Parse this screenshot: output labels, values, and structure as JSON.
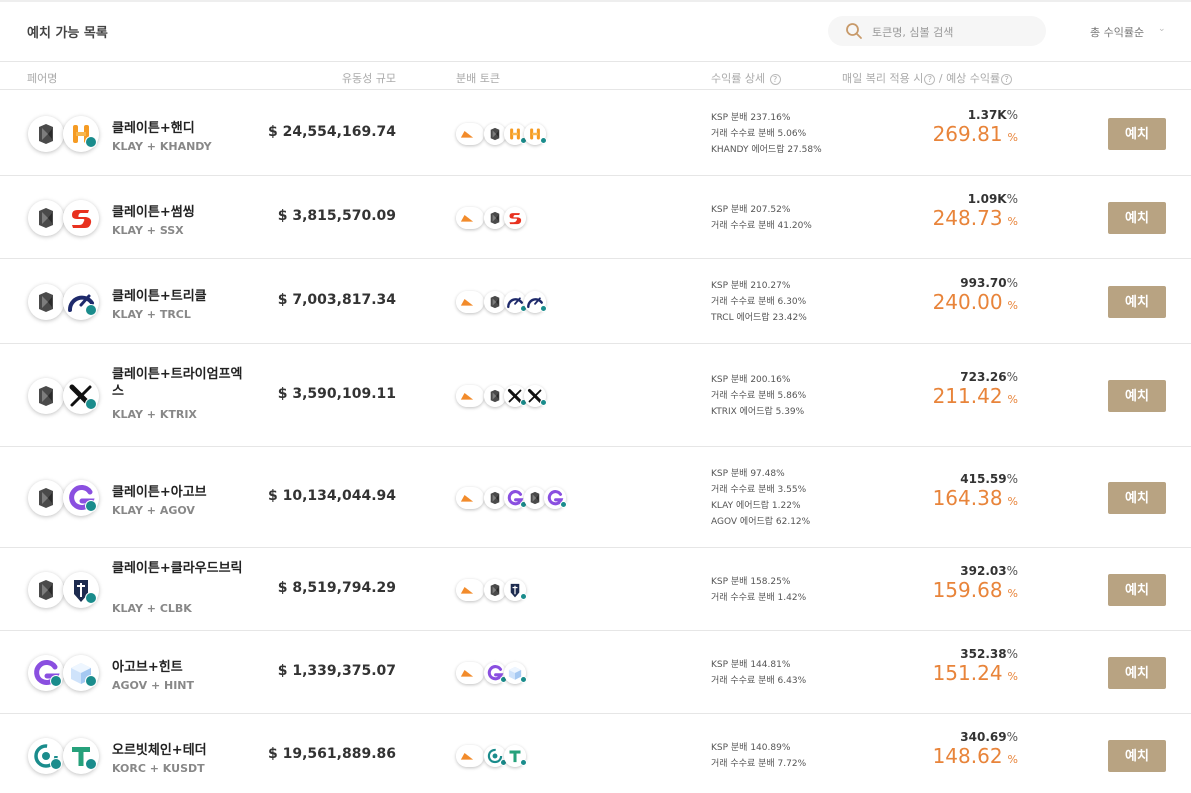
{
  "header": {
    "title": "예치 가능 목록",
    "search_placeholder": "토큰명, 심볼 검색",
    "sort_label": "총 수익률순"
  },
  "columns": {
    "pair": "페어명",
    "liquidity": "유동성 규모",
    "reward_tokens": "분배 토큰",
    "yield_detail": "수익률 상세",
    "daily_compound": "매일 복리 적용 시",
    "slash": "/",
    "expected_yield": "예상 수익률"
  },
  "colors": {
    "accent_orange": "#e8843a",
    "button_bg": "#b8a382",
    "badge_teal": "#1a8c8c"
  },
  "pct_sign": "%",
  "deposit_label": "예치",
  "pools": [
    {
      "name": "클레이튼+핸디",
      "symbols": "KLAY + KHANDY",
      "tvl": "$ 24,554,169.74",
      "token_a_icon": "klay-icon",
      "token_b_icon": "khandy-icon",
      "details": [
        "KSP 분배 237.16%",
        "거래 수수료 분배 5.06%",
        "KHANDY 에어드랍 27.58%"
      ],
      "daily": "1.37K",
      "apr": "269.81",
      "dist_icons": [
        "ksp-icon",
        "klay-icon",
        "khandy-icon",
        "khandy-icon"
      ]
    },
    {
      "name": "클레이튼+썸씽",
      "symbols": "KLAY + SSX",
      "tvl": "$ 3,815,570.09",
      "token_a_icon": "klay-icon",
      "token_b_icon": "ssx-icon",
      "details": [
        "KSP 분배 207.52%",
        "거래 수수료 분배 41.20%"
      ],
      "daily": "1.09K",
      "apr": "248.73",
      "dist_icons": [
        "ksp-icon",
        "klay-icon",
        "ssx-icon"
      ]
    },
    {
      "name": "클레이튼+트리클",
      "symbols": "KLAY + TRCL",
      "tvl": "$ 7,003,817.34",
      "token_a_icon": "klay-icon",
      "token_b_icon": "trcl-icon",
      "details": [
        "KSP 분배 210.27%",
        "거래 수수료 분배 6.30%",
        "TRCL 에어드랍 23.42%"
      ],
      "daily": "993.70",
      "apr": "240.00",
      "dist_icons": [
        "ksp-icon",
        "klay-icon",
        "trcl-icon",
        "trcl-icon"
      ]
    },
    {
      "name": "클레이튼+트라이엄프엑스",
      "symbols": "KLAY + KTRIX",
      "tvl": "$ 3,590,109.11",
      "token_a_icon": "klay-icon",
      "token_b_icon": "ktrix-icon",
      "details": [
        "KSP 분배 200.16%",
        "거래 수수료 분배 5.86%",
        "KTRIX 에어드랍 5.39%"
      ],
      "daily": "723.26",
      "apr": "211.42",
      "dist_icons": [
        "ksp-icon",
        "klay-icon",
        "ktrix-icon",
        "ktrix-icon"
      ]
    },
    {
      "name": "클레이튼+아고브",
      "symbols": "KLAY + AGOV",
      "tvl": "$ 10,134,044.94",
      "token_a_icon": "klay-icon",
      "token_b_icon": "agov-icon",
      "details": [
        "KSP 분배 97.48%",
        "거래 수수료 분배 3.55%",
        "KLAY 에어드랍 1.22%",
        "AGOV 에어드랍 62.12%"
      ],
      "daily": "415.59",
      "apr": "164.38",
      "dist_icons": [
        "ksp-icon",
        "klay-icon",
        "agov-icon",
        "klay-icon",
        "agov-icon"
      ]
    },
    {
      "name": "클레이튼+클라우드브릭",
      "symbols": "KLAY + CLBK",
      "tvl": "$ 8,519,794.29",
      "token_a_icon": "klay-icon",
      "token_b_icon": "clbk-icon",
      "details": [
        "KSP 분배 158.25%",
        "거래 수수료 분배 1.42%"
      ],
      "daily": "392.03",
      "apr": "159.68",
      "dist_icons": [
        "ksp-icon",
        "klay-icon",
        "clbk-icon"
      ]
    },
    {
      "name": "아고브+힌트",
      "symbols": "AGOV + HINT",
      "tvl": "$ 1,339,375.07",
      "token_a_icon": "agov-icon",
      "token_b_icon": "hint-icon",
      "details": [
        "KSP 분배 144.81%",
        "거래 수수료 분배 6.43%"
      ],
      "daily": "352.38",
      "apr": "151.24",
      "dist_icons": [
        "ksp-icon",
        "agov-icon",
        "hint-icon"
      ]
    },
    {
      "name": "오르빗체인+테더",
      "symbols": "KORC + KUSDT",
      "tvl": "$ 19,561,889.86",
      "token_a_icon": "korc-icon",
      "token_b_icon": "kusdt-icon",
      "details": [
        "KSP 분배 140.89%",
        "거래 수수료 분배 7.72%"
      ],
      "daily": "340.69",
      "apr": "148.62",
      "dist_icons": [
        "ksp-icon",
        "korc-icon",
        "kusdt-icon"
      ]
    }
  ]
}
